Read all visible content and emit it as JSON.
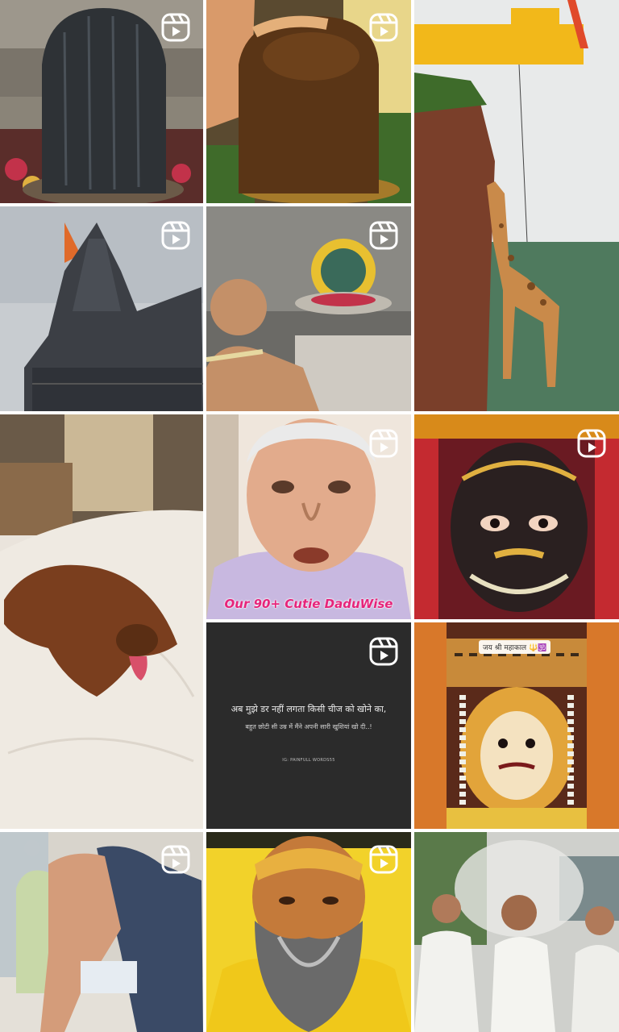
{
  "grid": {
    "tiles": [
      {
        "id": "tile-shivling-water",
        "is_reel": true
      },
      {
        "id": "tile-shivling-hands",
        "is_reel": true
      },
      {
        "id": "tile-giraffe-crane",
        "is_reel": false
      },
      {
        "id": "tile-temple-spire",
        "is_reel": true
      },
      {
        "id": "tile-mahakal-prayer",
        "is_reel": true
      },
      {
        "id": "tile-dog-bed",
        "is_reel": false
      },
      {
        "id": "tile-elder-man",
        "is_reel": true,
        "caption": "Our 90+ Cutie DaduWise"
      },
      {
        "id": "tile-mahakal-face",
        "is_reel": true
      },
      {
        "id": "tile-text-quote",
        "is_reel": true,
        "line1": "अब मुझे डर नहीं लगता किसी चीज को खोने का,",
        "line2": "बहुत छोटी सी उम्र में मैंने अपनी सारी खुशियां खो दी..!",
        "credit": "IG: PAINFULL WORDS55"
      },
      {
        "id": "tile-mahakal-decorated",
        "is_reel": false,
        "badge": "जय श्री महाकाल 🔱🕉️"
      },
      {
        "id": "tile-hospital-hug",
        "is_reel": true
      },
      {
        "id": "tile-sadhu-yellow",
        "is_reel": true
      },
      {
        "id": "tile-crowd-smoke",
        "is_reel": false
      }
    ]
  },
  "icons": {
    "reel": "reels-icon"
  },
  "colors": {
    "reel_icon": "#ffffff",
    "caption_pink": "#e6247a",
    "text_tile_bg": "#2b2b2b"
  }
}
